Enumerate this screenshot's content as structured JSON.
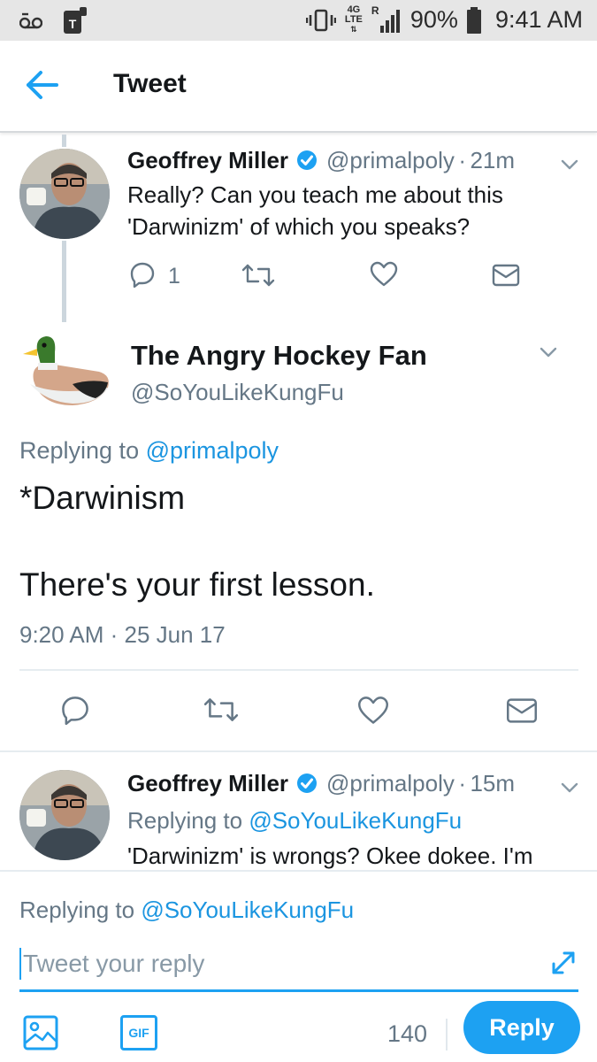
{
  "status_bar": {
    "network_top": "4G",
    "network_bottom": "LTE",
    "roaming": "R",
    "battery": "90%",
    "time": "9:41 AM"
  },
  "header": {
    "title": "Tweet"
  },
  "tweet1": {
    "name": "Geoffrey Miller",
    "handle": "@primalpoly",
    "separator": "·",
    "time": "21m",
    "line1": "Really? Can you teach me about this",
    "line2": "'Darwinizm' of which you speaks?",
    "reply_count": "1"
  },
  "main_tweet": {
    "name": "The Angry Hockey Fan",
    "handle": "@SoYouLikeKungFu",
    "replying_prefix": "Replying to",
    "replying_to": "@primalpoly",
    "line1": "*Darwinism",
    "line2": "There's your first lesson.",
    "timestamp": "9:20 AM · 25 Jun 17"
  },
  "tweet3": {
    "name": "Geoffrey Miller",
    "handle": "@primalpoly",
    "separator": "·",
    "time": "15m",
    "replying_prefix": "Replying to",
    "replying_to": "@SoYouLikeKungFu",
    "line1": "'Darwinizm' is wrongs? Okee dokee. I'm"
  },
  "composer": {
    "replying_prefix": "Replying to",
    "replying_to": "@SoYouLikeKungFu",
    "placeholder": "Tweet your reply",
    "gif_label": "GIF",
    "char_count": "140",
    "reply_button": "Reply"
  },
  "colors": {
    "accent": "#1da1f2",
    "link": "#1b95e0",
    "muted": "#657786",
    "verified": "#1da1f2"
  },
  "icons": [
    "back-arrow-icon",
    "verified-badge-icon",
    "chevron-down-icon",
    "reply-icon",
    "retweet-icon",
    "like-icon",
    "direct-message-icon",
    "image-icon",
    "gif-icon",
    "expand-icon"
  ]
}
